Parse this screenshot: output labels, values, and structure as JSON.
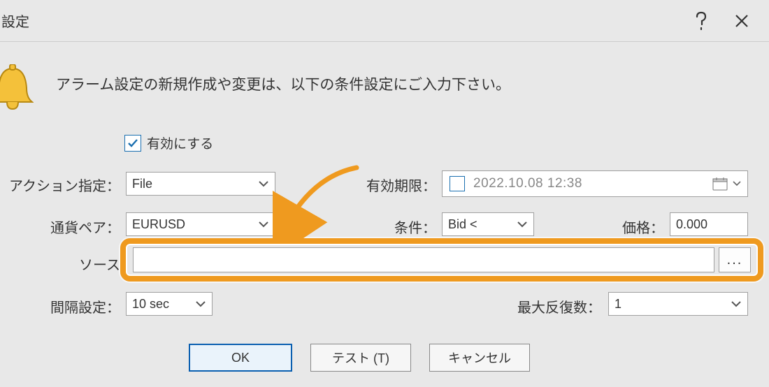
{
  "title": "設定",
  "banner": "アラーム設定の新規作成や変更は、以下の条件設定にご入力下さい。",
  "enable": {
    "label": "有効にする",
    "checked": true
  },
  "labels": {
    "action": "アクション指定：",
    "expiry": "有効期限：",
    "pair": "通貨ペア：",
    "condition": "条件：",
    "price": "価格：",
    "source": "ソース",
    "interval": "間隔設定：",
    "repeat": "最大反復数："
  },
  "values": {
    "action": "File",
    "expiry": "2022.10.08 12:38",
    "pair": "EURUSD",
    "condition": "Bid <",
    "price": "0.000",
    "source": "",
    "interval": "10 sec",
    "repeat": "1"
  },
  "buttons": {
    "ok": "OK",
    "test": "テスト (T)",
    "cancel": "キャンセル",
    "browse": "..."
  }
}
